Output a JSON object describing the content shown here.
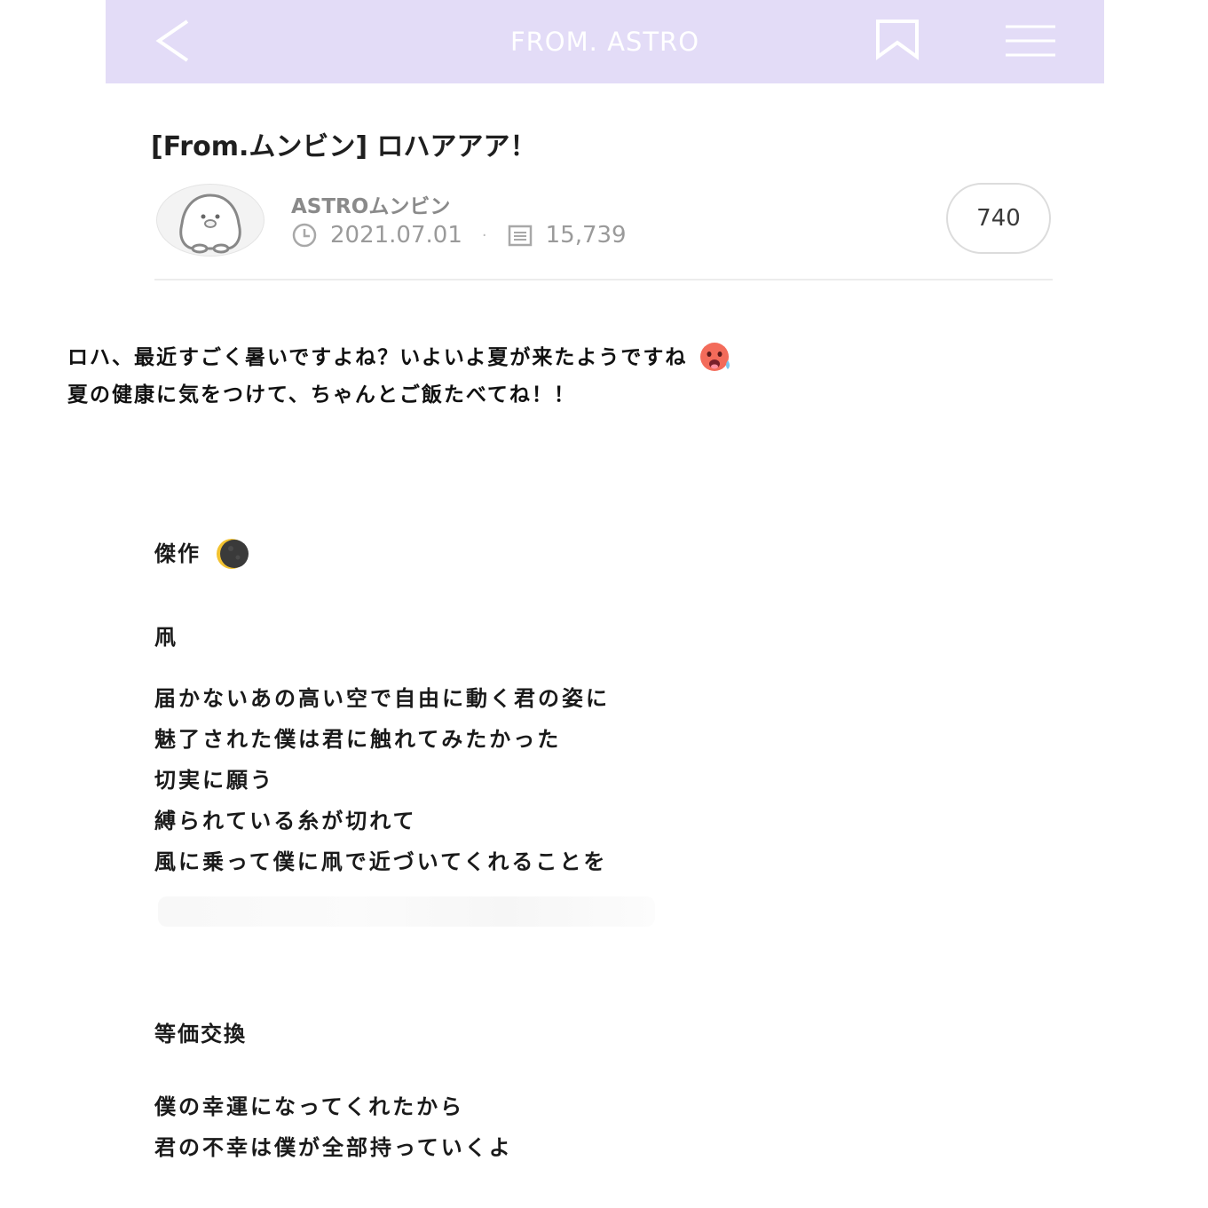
{
  "topbar": {
    "title": "FROM. ASTRO",
    "back_icon": "chevron-left-icon",
    "bookmark_icon": "bookmark-icon",
    "menu_icon": "hamburger-menu-icon",
    "background": "#e3dcf7"
  },
  "post": {
    "title": "[From.ムンビン] ロハアアア！",
    "author": "ASTROムンビン",
    "date": "2021.07.01",
    "views": "15,739",
    "likes": "740"
  },
  "intro": {
    "line1": "ロハ、最近すごく暑いですよね？いよいよ夏が来たようですね",
    "line2": "夏の健康に気をつけて、ちゃんとご飯たべてね！！"
  },
  "section1": {
    "heading": "傑作",
    "subheading": "凧",
    "lines": [
      "届かないあの高い空で自由に動く君の姿に",
      "魅了された僕は君に触れてみたかった",
      "切実に願う",
      "縛られている糸が切れて",
      "風に乗って僕に凧で近づいてくれることを"
    ]
  },
  "section2": {
    "heading": "等価交換",
    "lines": [
      "僕の幸運になってくれたから",
      "君の不幸は僕が全部持っていくよ"
    ]
  }
}
